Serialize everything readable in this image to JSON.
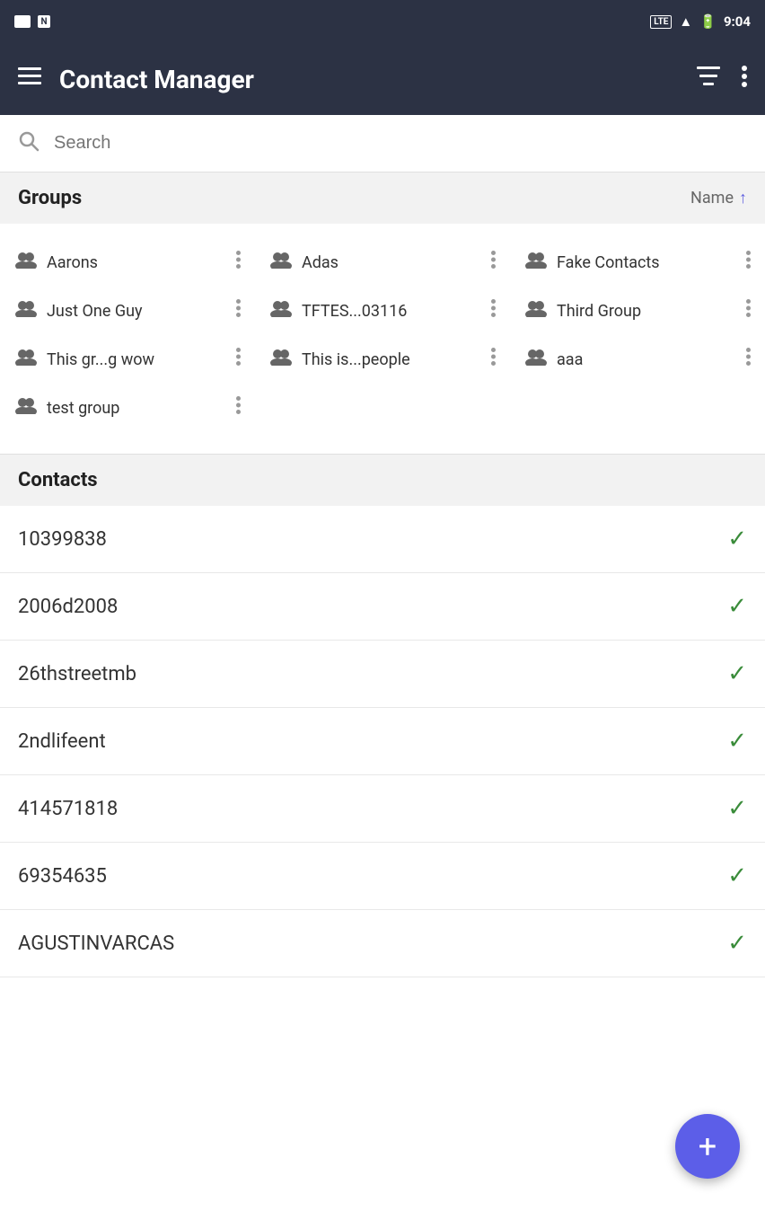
{
  "statusBar": {
    "time": "9:04",
    "lte": "LTE",
    "signal": "signal-icon",
    "battery": "battery-icon"
  },
  "appBar": {
    "title": "Contact Manager",
    "hamburgerLabel": "menu",
    "filterLabel": "filter",
    "moreLabel": "more"
  },
  "search": {
    "placeholder": "Search"
  },
  "groups": {
    "sectionLabel": "Groups",
    "sortLabel": "Name",
    "items": [
      {
        "name": "Aarons"
      },
      {
        "name": "Adas"
      },
      {
        "name": "Fake Contacts"
      },
      {
        "name": "Just One Guy"
      },
      {
        "name": "TFTES...03116"
      },
      {
        "name": "Third Group"
      },
      {
        "name": "This gr...g wow"
      },
      {
        "name": "This is...people"
      },
      {
        "name": "aaa"
      },
      {
        "name": "test group"
      }
    ]
  },
  "contacts": {
    "sectionLabel": "Contacts",
    "items": [
      {
        "name": "10399838"
      },
      {
        "name": "2006d2008"
      },
      {
        "name": "26thstreetmb"
      },
      {
        "name": "2ndlifeent"
      },
      {
        "name": "414571818"
      },
      {
        "name": "69354635"
      },
      {
        "name": "AGUSTINVARCAS"
      }
    ]
  },
  "fab": {
    "label": "+"
  }
}
